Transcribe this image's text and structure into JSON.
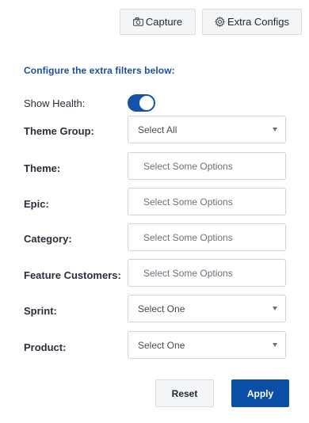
{
  "toolbar": {
    "capture_label": "Capture",
    "extra_configs_label": "Extra Configs"
  },
  "section": {
    "title": "Configure the extra filters below:"
  },
  "health": {
    "label": "Show Health:",
    "enabled": true
  },
  "filters": {
    "theme_group": {
      "label": "Theme Group:",
      "value": "Select All"
    },
    "theme": {
      "label": "Theme:",
      "placeholder": "Select Some Options"
    },
    "epic": {
      "label": "Epic:",
      "placeholder": "Select Some Options"
    },
    "category": {
      "label": "Category:",
      "placeholder": "Select Some Options"
    },
    "feature_customers": {
      "label": "Feature Customers:",
      "placeholder": "Select Some Options"
    },
    "sprint": {
      "label": "Sprint:",
      "value": "Select One"
    },
    "product": {
      "label": "Product:",
      "value": "Select One"
    }
  },
  "actions": {
    "reset_label": "Reset",
    "apply_label": "Apply"
  },
  "colors": {
    "accent": "#0b4ea5",
    "title": "#1a4f9c"
  },
  "icons": {
    "capture": "camera-icon",
    "extra_configs": "gear-icon",
    "dropdown": "caret-down-icon"
  }
}
